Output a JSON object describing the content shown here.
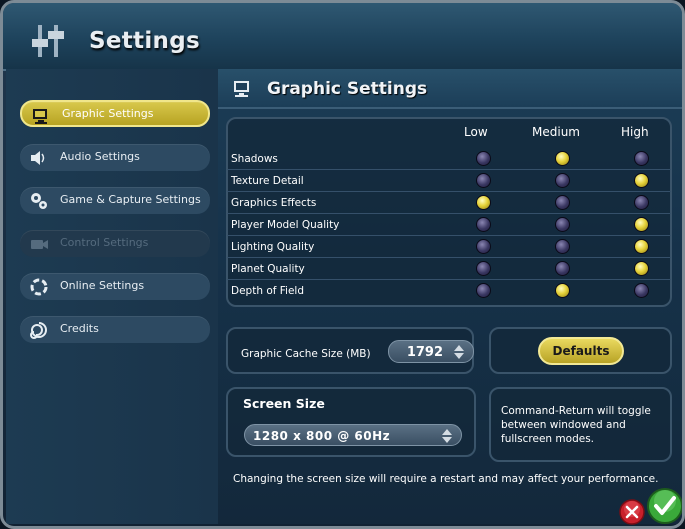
{
  "window": {
    "title": "Settings"
  },
  "sidebar": {
    "items": [
      {
        "label": "Graphic Settings",
        "icon": "monitor-icon",
        "state": "active"
      },
      {
        "label": "Audio Settings",
        "icon": "speaker-icon",
        "state": "normal"
      },
      {
        "label": "Game & Capture Settings",
        "icon": "gears-icon",
        "state": "normal"
      },
      {
        "label": "Control Settings",
        "icon": "camera-icon",
        "state": "disabled"
      },
      {
        "label": "Online Settings",
        "icon": "online-icon",
        "state": "normal"
      },
      {
        "label": "Credits",
        "icon": "spiral-icon",
        "state": "normal"
      }
    ]
  },
  "main": {
    "title": "Graphic Settings",
    "quality_table": {
      "columns": [
        "Low",
        "Medium",
        "High"
      ],
      "rows": [
        {
          "label": "Shadows",
          "selected": "Medium"
        },
        {
          "label": "Texture Detail",
          "selected": "High"
        },
        {
          "label": "Graphics Effects",
          "selected": "Low"
        },
        {
          "label": "Player Model Quality",
          "selected": "High"
        },
        {
          "label": "Lighting Quality",
          "selected": "High"
        },
        {
          "label": "Planet Quality",
          "selected": "High"
        },
        {
          "label": "Depth of Field",
          "selected": "Medium"
        }
      ]
    },
    "cache": {
      "label": "Graphic Cache Size (MB)",
      "value": "1792"
    },
    "defaults_button": "Defaults",
    "screen_size": {
      "title": "Screen Size",
      "value": "1280 x 800 @ 60Hz"
    },
    "toggle_note": "Command-Return will toggle between windowed and fullscreen modes.",
    "footer_note": "Changing the screen size will require a restart and may affect your performance."
  },
  "colors": {
    "accent": "#d8c84c",
    "background": "#16324a",
    "cancel": "#c8202b",
    "confirm": "#3aa93a"
  }
}
